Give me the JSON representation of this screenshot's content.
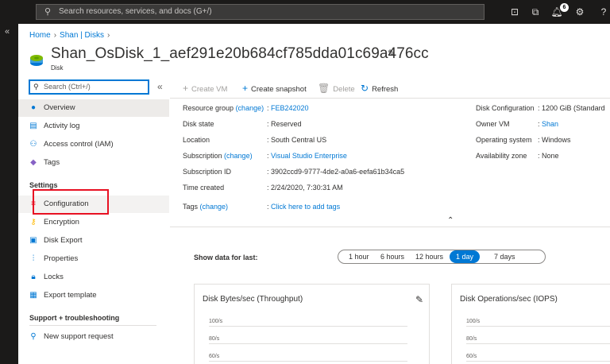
{
  "topbar": {
    "search_placeholder": "Search resources, services, and docs (G+/)",
    "notification_count": "6"
  },
  "rail": {
    "expand_glyph": "«"
  },
  "breadcrumb": [
    {
      "label": "Home"
    },
    {
      "label": "Shan | Disks"
    }
  ],
  "header": {
    "title": "Shan_OsDisk_1_aef291e20b684cf785dda01c69a476cc",
    "subtitle": "Disk"
  },
  "sidebar": {
    "search_placeholder": "Search (Ctrl+/)",
    "items_top": [
      {
        "label": "Overview",
        "icon": "disk-icon"
      },
      {
        "label": "Activity log",
        "icon": "activity-log-icon"
      },
      {
        "label": "Access control (IAM)",
        "icon": "people-icon"
      },
      {
        "label": "Tags",
        "icon": "tag-icon"
      }
    ],
    "settings_header": "Settings",
    "items_settings": [
      {
        "label": "Configuration",
        "icon": "configuration-icon"
      },
      {
        "label": "Encryption",
        "icon": "key-icon"
      },
      {
        "label": "Disk Export",
        "icon": "export-icon"
      },
      {
        "label": "Properties",
        "icon": "properties-icon"
      },
      {
        "label": "Locks",
        "icon": "lock-icon"
      },
      {
        "label": "Export template",
        "icon": "template-icon"
      }
    ],
    "support_header": "Support + troubleshooting",
    "items_support": [
      {
        "label": "New support request",
        "icon": "person-support-icon"
      }
    ]
  },
  "toolbar": {
    "create_vm": "Create VM",
    "create_snapshot": "Create snapshot",
    "delete": "Delete",
    "refresh": "Refresh"
  },
  "essentials": {
    "left": [
      {
        "label": "Resource group",
        "change": "(change)",
        "value": "FEB242020",
        "value_link": true
      },
      {
        "label": "Disk state",
        "value": "Reserved"
      },
      {
        "label": "Location",
        "value": "South Central US"
      },
      {
        "label": "Subscription",
        "change": "(change)",
        "value": "Visual Studio Enterprise",
        "value_link": true
      },
      {
        "label": "Subscription ID",
        "value": "3902ccd9-9777-4de2-a0a6-eefa61b34ca5"
      },
      {
        "label": "Time created",
        "value": "2/24/2020, 7:30:31 AM"
      },
      {
        "label": "Tags",
        "change": "(change)",
        "value": "Click here to add tags",
        "value_link": true
      }
    ],
    "right": [
      {
        "label": "Disk Configuration",
        "value": "1200 GiB (Standard"
      },
      {
        "label": "Owner VM",
        "value": "Shan",
        "value_link": true
      },
      {
        "label": "Operating system",
        "value": "Windows"
      },
      {
        "label": "Availability zone",
        "value": "None"
      }
    ],
    "separator": ":"
  },
  "time_range": {
    "label": "Show data for last:",
    "options": [
      "1 hour",
      "6 hours",
      "12 hours",
      "1 day",
      "7 days"
    ],
    "selected": "1 day"
  },
  "charts": [
    {
      "title": "Disk Bytes/sec (Throughput)",
      "ticks": [
        "100/s",
        "80/s",
        "60/s"
      ]
    },
    {
      "title": "Disk Operations/sec (IOPS)",
      "ticks": [
        "100/s",
        "80/s",
        "60/s"
      ]
    }
  ],
  "colors": {
    "accent": "#0078d4",
    "highlight": "#e81123"
  }
}
